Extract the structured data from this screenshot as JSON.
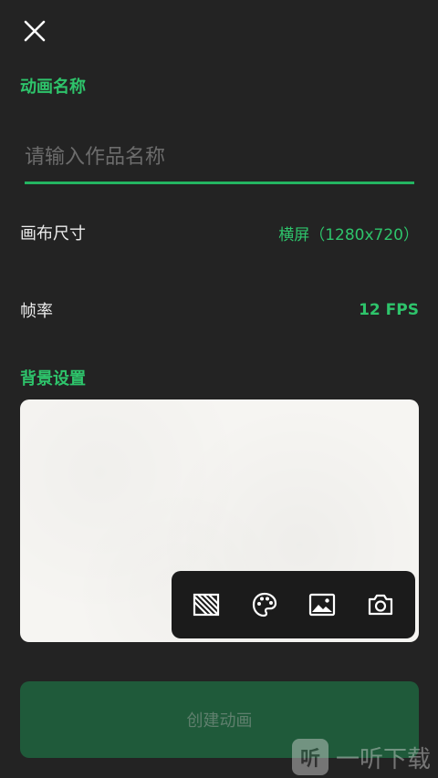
{
  "header": {
    "close_icon": "close-icon"
  },
  "name_section": {
    "label": "动画名称",
    "input_placeholder": "请输入作品名称",
    "input_value": ""
  },
  "canvas_size": {
    "label": "画布尺寸",
    "value": "横屏（1280x720）"
  },
  "frame_rate": {
    "label": "帧率",
    "value": "12 FPS"
  },
  "background_section": {
    "label": "背景设置",
    "tools": [
      {
        "icon": "transparent-pattern-icon"
      },
      {
        "icon": "palette-icon"
      },
      {
        "icon": "image-icon"
      },
      {
        "icon": "camera-icon"
      }
    ]
  },
  "create_button": {
    "label": "创建动画"
  },
  "watermark": {
    "logo_text": "听",
    "text": "一听下载"
  },
  "colors": {
    "background": "#232323",
    "accent": "#2ec46b",
    "button_bg": "#1f5a3a",
    "toolbar_bg": "#1b1b1b"
  }
}
